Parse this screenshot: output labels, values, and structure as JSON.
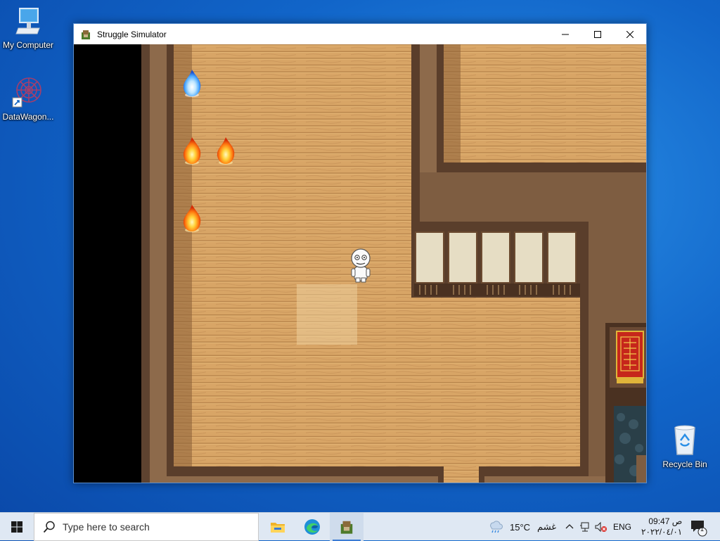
{
  "desktop": {
    "icons": [
      {
        "label": "My Computer",
        "icon": "computer-icon"
      },
      {
        "label": "DataWagon...",
        "icon": "datawagon-icon"
      },
      {
        "label": "Recycle Bin",
        "icon": "recycle-bin-icon"
      }
    ]
  },
  "window": {
    "title": "Struggle Simulator",
    "controls": {
      "minimize": "minimize-icon",
      "maximize": "maximize-icon",
      "close": "close-icon"
    }
  },
  "game": {
    "flames": [
      {
        "type": "blue"
      },
      {
        "type": "red"
      },
      {
        "type": "red"
      },
      {
        "type": "red"
      }
    ],
    "character": "player-character"
  },
  "taskbar": {
    "search_placeholder": "Type here to search",
    "apps": [
      "file-explorer-icon",
      "edge-icon",
      "struggle-simulator-icon"
    ],
    "weather_temp": "15°C",
    "weather_desc": "غشم",
    "lang": "ENG",
    "time": "09:47 ص",
    "date": "٢٠٢٢/٠٤/٠١",
    "notification_count": "1"
  },
  "colors": {
    "accent": "#3b7bd4",
    "floor": "#d4a264",
    "wall": "#7b5a3e"
  }
}
